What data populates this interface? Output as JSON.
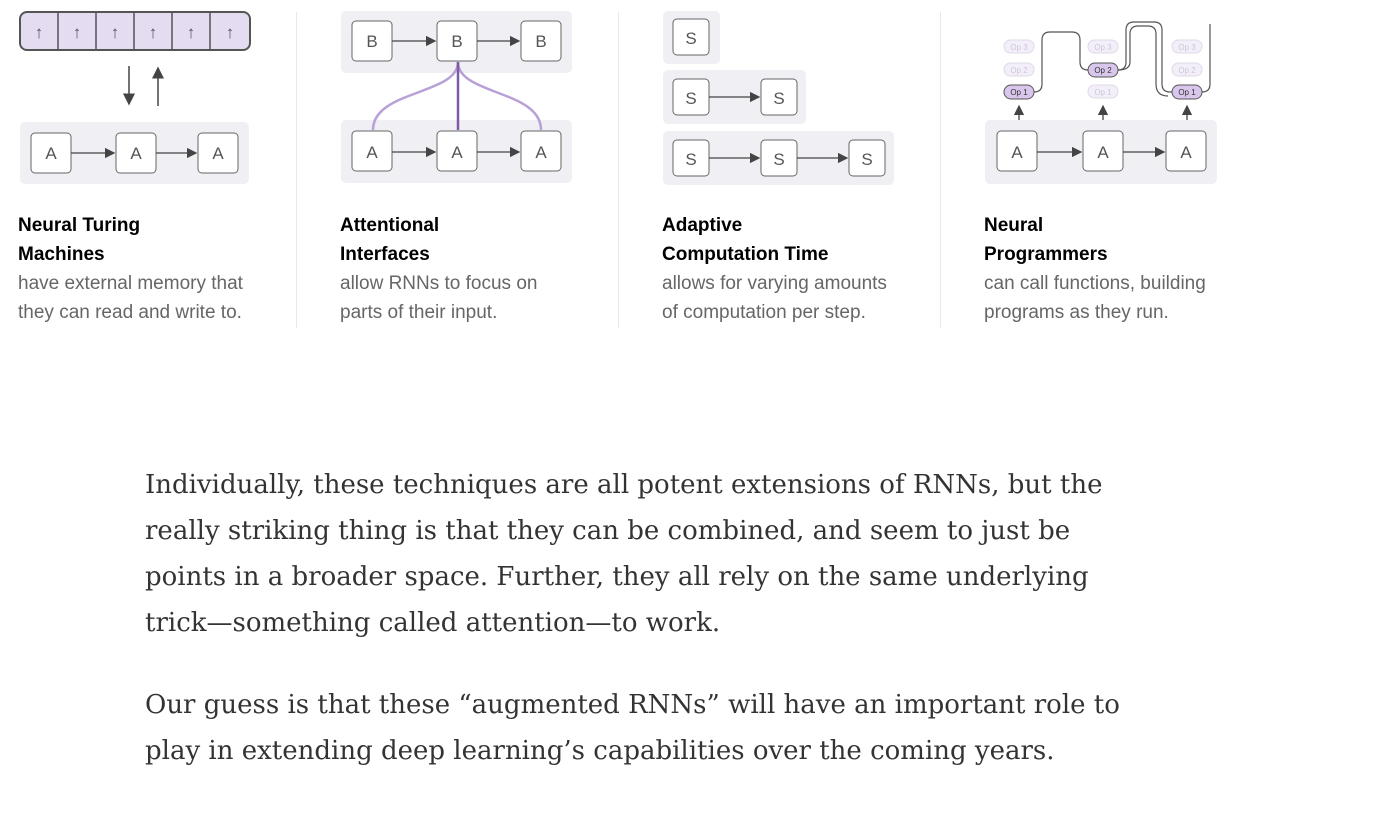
{
  "figures": [
    {
      "title_line1": "Neural Turing",
      "title_line2": "Machines",
      "desc_line1": "have external memory that",
      "desc_line2": "they can read and write to.",
      "memory_cells": [
        "↑",
        "↑",
        "↑",
        "↑",
        "↑",
        "↑"
      ],
      "arrows": [
        "↓",
        "↑"
      ],
      "nodes": [
        "A",
        "A",
        "A"
      ]
    },
    {
      "title_line1": "Attentional",
      "title_line2": "Interfaces",
      "desc_line1": "allow RNNs to focus on",
      "desc_line2": "parts of their input.",
      "top_nodes": [
        "B",
        "B",
        "B"
      ],
      "nodes": [
        "A",
        "A",
        "A"
      ]
    },
    {
      "title_line1": "Adaptive",
      "title_line2": "Computation Time",
      "desc_line1": "allows for varying amounts",
      "desc_line2": "of computation per step.",
      "row1": [
        "S"
      ],
      "row2": [
        "S",
        "S"
      ],
      "row3": [
        "S",
        "S",
        "S"
      ]
    },
    {
      "title_line1": "Neural",
      "title_line2": "Programmers",
      "desc_line1": "can call functions, building",
      "desc_line2": "programs as they run.",
      "ops": [
        "Op 3",
        "Op 2",
        "Op 1"
      ],
      "nodes": [
        "A",
        "A",
        "A"
      ]
    }
  ],
  "prose": {
    "p1_line1": "Individually, these techniques are all potent extensions of RNNs, but the",
    "p1_line2": "really striking thing is that they can be combined, and seem to just be",
    "p1_line3": "points in a broader space. Further, they all rely on the same underlying",
    "p1_line4": "trick—something called attention—to work.",
    "p2_line1": "Our guess is that these “augmented RNNs” will have an important role to",
    "p2_line2": "play in extending deep learning’s capabilities over the coming years."
  },
  "colors": {
    "panel": "#f0eff3",
    "memory": "#e4dcf0",
    "attention": "#b8a1d6",
    "op_active": "#d8c6ec"
  }
}
